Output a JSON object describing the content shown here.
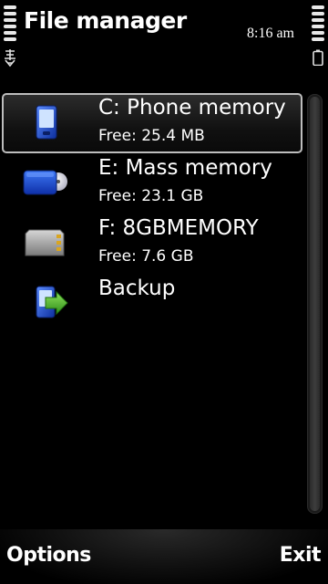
{
  "status_bar": {
    "title": "File manager",
    "time": "8:16 am",
    "signal_icon": "signal-strength-icon",
    "battery_icon": "battery-icon",
    "network_icon": "packet-data-icon"
  },
  "drives": [
    {
      "title": "C: Phone memory",
      "subtitle": "Free: 25.4 MB",
      "icon": "phone-memory-icon",
      "selected": true
    },
    {
      "title": "E: Mass memory",
      "subtitle": "Free: 23.1 GB",
      "icon": "mass-memory-icon",
      "selected": false
    },
    {
      "title": "F: 8GBMEMORY",
      "subtitle": "Free: 7.6 GB",
      "icon": "memory-card-icon",
      "selected": false
    },
    {
      "title": "Backup",
      "icon": "backup-icon",
      "selected": false
    }
  ],
  "softkeys": {
    "left": "Options",
    "right": "Exit"
  },
  "colors": {
    "background": "#000000",
    "text": "#ffffff",
    "highlight_border": "#bdbdbd",
    "phone_blue": "#1b4fd8",
    "card_gray": "#9a9a9a",
    "arrow_green": "#4caf2a"
  }
}
